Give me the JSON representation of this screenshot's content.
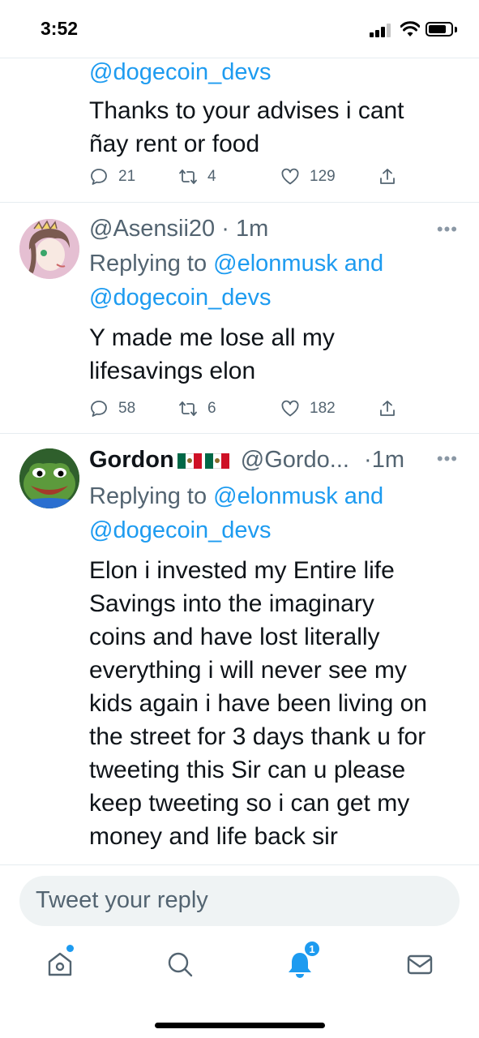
{
  "status_bar": {
    "time": "3:52"
  },
  "tweets": [
    {
      "reply_mention_line": "@dogecoin_devs",
      "text_lines": [
        "Thanks to your advises i cant",
        "ñay rent or food"
      ],
      "replies": "21",
      "retweets": "4",
      "likes": "129"
    },
    {
      "handle_time": "@Asensii20 · 1m",
      "reply_prefix": "Replying to ",
      "reply_mention_1": "@elonmusk and",
      "reply_mention_2": "@dogecoin_devs",
      "text_lines": [
        "Y made me lose all my",
        "lifesavings elon"
      ],
      "replies": "58",
      "retweets": "6",
      "likes": "182"
    },
    {
      "name": "Gordon",
      "handle": "@Gordo...",
      "time": "·1m",
      "reply_prefix": "Replying to ",
      "reply_mention_1": "@elonmusk and",
      "reply_mention_2": "@dogecoin_devs",
      "text_lines": [
        "Elon i invested my Entire life",
        "Savings into the imaginary",
        "coins and have lost literally",
        "everything i will never see my",
        "kids again i have been living on",
        "the street for 3 days thank u for",
        "tweeting this Sir can u please",
        "keep tweeting so i can get my",
        "money and life back sir"
      ]
    }
  ],
  "reply_box": {
    "placeholder": "Tweet your reply"
  },
  "tabbar": {
    "notifications_badge": "1"
  },
  "colors": {
    "accent": "#1d9bf0",
    "secondary_text": "#536471"
  },
  "icons": [
    "home-icon",
    "search-icon",
    "notifications-bell-icon",
    "messages-mail-icon"
  ]
}
